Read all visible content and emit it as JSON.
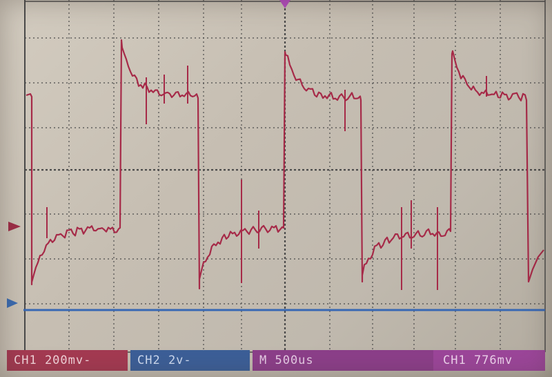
{
  "status_bar": {
    "ch1": "CH1 200mv-",
    "ch2": "CH2 2v-",
    "timebase": "M 500us",
    "trigger": "CH1 776mv"
  },
  "colors": {
    "screen_bg": "#c6beb2",
    "grid": "#4a4a4a",
    "ch1_trace": "#a62a48",
    "ch2_trace": "#3868b4",
    "trigger_marker": "#b54cc0"
  },
  "icons": {
    "ch1_ground_marker": "right-pointing triangle",
    "ch2_ground_marker": "right-pointing triangle",
    "trigger_position_marker": "down-pointing triangle"
  }
}
